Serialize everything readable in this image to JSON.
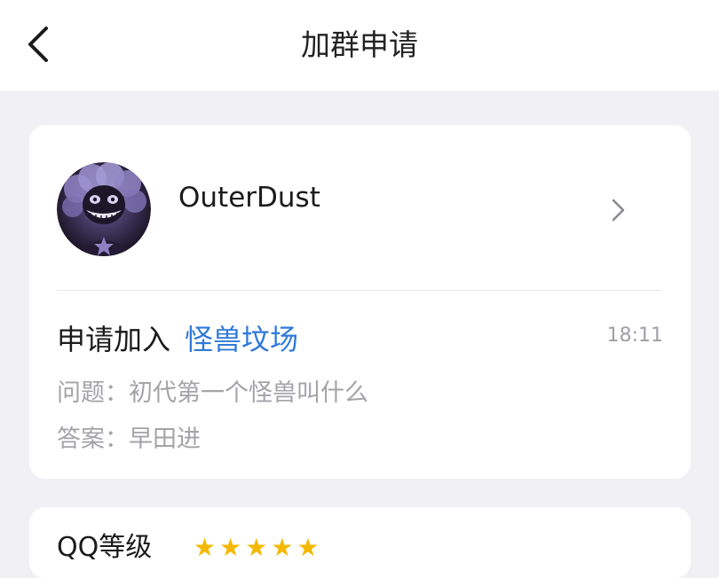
{
  "header": {
    "title": "加群申请",
    "back_icon": "chevron-left-icon"
  },
  "request": {
    "username": "OuterDust",
    "avatar_icon": "grinning-creature-avatar",
    "chevron_icon": "chevron-right-icon",
    "request_prefix": "申请加入",
    "group_name": "怪兽坟场",
    "time": "18:11",
    "question": "问题：初代第一个怪兽叫什么",
    "answer": "答案：早田进"
  },
  "level": {
    "label": "QQ等级",
    "stars": "★★★★★",
    "star_color": "#f5b800"
  },
  "colors": {
    "accent": "#2f7ad9",
    "background": "#f1f1f5",
    "secondary_text": "#a3a3a8"
  }
}
